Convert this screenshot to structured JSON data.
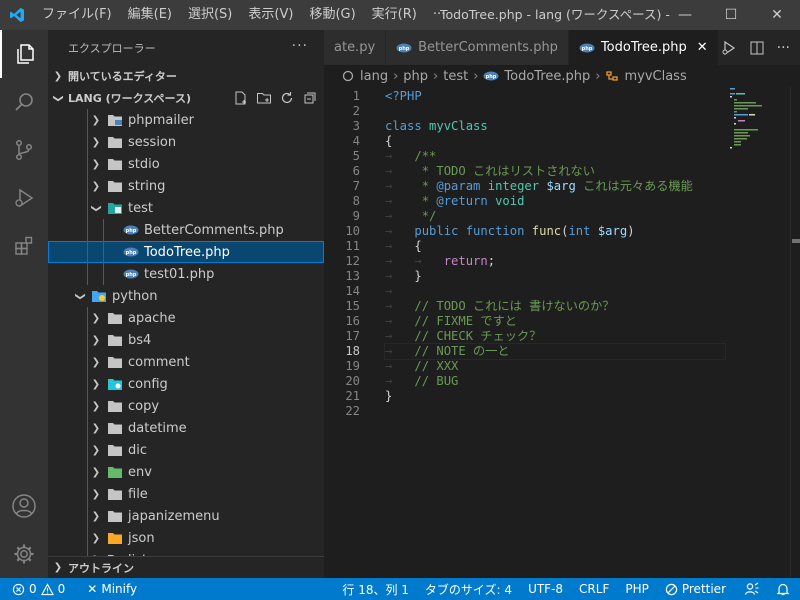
{
  "titlebar": {
    "menu": [
      "ファイル(F)",
      "編集(E)",
      "選択(S)",
      "表示(V)",
      "移動(G)",
      "実行(R)",
      "···"
    ],
    "title": "TodoTree.php - lang (ワークスペース) - Visu…"
  },
  "sidebar": {
    "header": "エクスプローラー",
    "open_editors": "開いているエディター",
    "workspace": "LANG (ワークスペース)",
    "outline": "アウトライン",
    "tree": [
      {
        "label": "phpmailer",
        "type": "folder",
        "depth": 2,
        "expanded": false,
        "icon": "php-folder-icon"
      },
      {
        "label": "session",
        "type": "folder",
        "depth": 2,
        "expanded": false,
        "icon": "folder-icon"
      },
      {
        "label": "stdio",
        "type": "folder",
        "depth": 2,
        "expanded": false,
        "icon": "folder-icon"
      },
      {
        "label": "string",
        "type": "folder",
        "depth": 2,
        "expanded": false,
        "icon": "folder-icon"
      },
      {
        "label": "test",
        "type": "folder",
        "depth": 2,
        "expanded": true,
        "icon": "test-folder-icon"
      },
      {
        "label": "BetterComments.php",
        "type": "file",
        "depth": 3,
        "icon": "php-file-icon"
      },
      {
        "label": "TodoTree.php",
        "type": "file",
        "depth": 3,
        "icon": "php-file-icon",
        "selected": true
      },
      {
        "label": "test01.php",
        "type": "file",
        "depth": 3,
        "icon": "php-file-icon"
      },
      {
        "label": "python",
        "type": "folder",
        "depth": 1,
        "expanded": true,
        "icon": "python-folder-icon"
      },
      {
        "label": "apache",
        "type": "folder",
        "depth": 2,
        "expanded": false,
        "icon": "folder-icon"
      },
      {
        "label": "bs4",
        "type": "folder",
        "depth": 2,
        "expanded": false,
        "icon": "folder-icon"
      },
      {
        "label": "comment",
        "type": "folder",
        "depth": 2,
        "expanded": false,
        "icon": "folder-icon"
      },
      {
        "label": "config",
        "type": "folder",
        "depth": 2,
        "expanded": false,
        "icon": "config-folder-icon"
      },
      {
        "label": "copy",
        "type": "folder",
        "depth": 2,
        "expanded": false,
        "icon": "folder-icon"
      },
      {
        "label": "datetime",
        "type": "folder",
        "depth": 2,
        "expanded": false,
        "icon": "folder-icon"
      },
      {
        "label": "dic",
        "type": "folder",
        "depth": 2,
        "expanded": false,
        "icon": "folder-icon"
      },
      {
        "label": "env",
        "type": "folder",
        "depth": 2,
        "expanded": false,
        "icon": "env-folder-icon"
      },
      {
        "label": "file",
        "type": "folder",
        "depth": 2,
        "expanded": false,
        "icon": "folder-icon"
      },
      {
        "label": "japanizemenu",
        "type": "folder",
        "depth": 2,
        "expanded": false,
        "icon": "folder-icon"
      },
      {
        "label": "json",
        "type": "folder",
        "depth": 2,
        "expanded": false,
        "icon": "json-folder-icon"
      },
      {
        "label": "list",
        "type": "folder",
        "depth": 2,
        "expanded": false,
        "icon": "folder-icon"
      }
    ]
  },
  "tabs": [
    {
      "label": "ate.py",
      "icon": "",
      "active": false
    },
    {
      "label": "BetterComments.php",
      "icon": "php-file-icon",
      "active": false
    },
    {
      "label": "TodoTree.php",
      "icon": "php-file-icon",
      "active": true
    }
  ],
  "breadcrumb": [
    "lang",
    "php",
    "test",
    "TodoTree.php",
    "myvClass"
  ],
  "editor": {
    "current_line": 18,
    "lines": [
      [
        {
          "t": "<?PHP",
          "c": "k"
        }
      ],
      [],
      [
        {
          "t": "class ",
          "c": "k"
        },
        {
          "t": "myvClass",
          "c": "cls"
        }
      ],
      [
        {
          "t": "{",
          "c": "pl"
        }
      ],
      [
        {
          "t": "→   ",
          "c": "ar"
        },
        {
          "t": "/**",
          "c": "cm"
        }
      ],
      [
        {
          "t": "→   ",
          "c": "ar"
        },
        {
          "t": " * TODO これはリストされない",
          "c": "cm"
        }
      ],
      [
        {
          "t": "→   ",
          "c": "ar"
        },
        {
          "t": " * ",
          "c": "cm"
        },
        {
          "t": "@param",
          "c": "k"
        },
        {
          "t": " integer ",
          "c": "cls"
        },
        {
          "t": "$arg",
          "c": "v"
        },
        {
          "t": " これは元々ある機能",
          "c": "cm"
        }
      ],
      [
        {
          "t": "→   ",
          "c": "ar"
        },
        {
          "t": " * ",
          "c": "cm"
        },
        {
          "t": "@return",
          "c": "k"
        },
        {
          "t": " void",
          "c": "cls"
        }
      ],
      [
        {
          "t": "→   ",
          "c": "ar"
        },
        {
          "t": " */",
          "c": "cm"
        }
      ],
      [
        {
          "t": "→   ",
          "c": "ar"
        },
        {
          "t": "public function ",
          "c": "k"
        },
        {
          "t": "func",
          "c": "fn"
        },
        {
          "t": "(",
          "c": "pl"
        },
        {
          "t": "int ",
          "c": "k"
        },
        {
          "t": "$arg",
          "c": "v"
        },
        {
          "t": ")",
          "c": "pl"
        }
      ],
      [
        {
          "t": "→   ",
          "c": "ar"
        },
        {
          "t": "{",
          "c": "pl"
        }
      ],
      [
        {
          "t": "→   →   ",
          "c": "ar"
        },
        {
          "t": "return",
          "c": "kc"
        },
        {
          "t": ";",
          "c": "pl"
        }
      ],
      [
        {
          "t": "→   ",
          "c": "ar"
        },
        {
          "t": "}",
          "c": "pl"
        }
      ],
      [
        {
          "t": "→   ",
          "c": "ar"
        }
      ],
      [
        {
          "t": "→   ",
          "c": "ar"
        },
        {
          "t": "// TODO これには 書けないのか？",
          "c": "cm"
        }
      ],
      [
        {
          "t": "→   ",
          "c": "ar"
        },
        {
          "t": "// FIXME ですと",
          "c": "cm"
        }
      ],
      [
        {
          "t": "→   ",
          "c": "ar"
        },
        {
          "t": "// CHECK チェック？",
          "c": "cm"
        }
      ],
      [
        {
          "t": "→   ",
          "c": "ar"
        },
        {
          "t": "// NOTE の一と",
          "c": "cm"
        }
      ],
      [
        {
          "t": "→   ",
          "c": "ar"
        },
        {
          "t": "// XXX",
          "c": "cm"
        }
      ],
      [
        {
          "t": "→   ",
          "c": "ar"
        },
        {
          "t": "// BUG",
          "c": "cm"
        }
      ],
      [
        {
          "t": "}",
          "c": "pl"
        }
      ],
      []
    ]
  },
  "statusbar": {
    "errors": "0",
    "warnings": "0",
    "minify": "Minify",
    "position": "行 18、列 1",
    "tabsize": "タブのサイズ: 4",
    "encoding": "UTF-8",
    "eol": "CRLF",
    "language": "PHP",
    "prettier": "Prettier"
  },
  "colors": {
    "accent": "#007acc",
    "selection": "#094771"
  }
}
